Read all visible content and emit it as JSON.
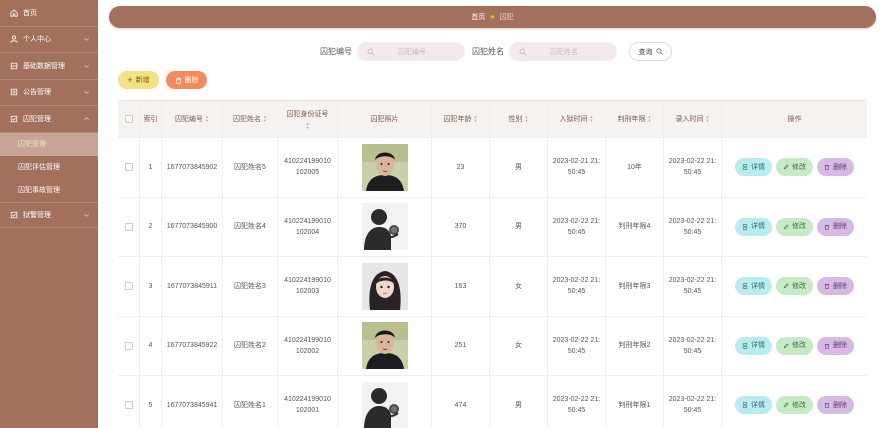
{
  "sidebar": {
    "items": [
      {
        "label": "首页",
        "icon": "home-icon"
      },
      {
        "label": "个人中心",
        "icon": "user-icon"
      },
      {
        "label": "基础数据管理",
        "icon": "database-icon"
      },
      {
        "label": "公告管理",
        "icon": "notice-icon"
      },
      {
        "label": "囚犯管理",
        "icon": "prisoner-icon"
      }
    ],
    "sub_items": [
      {
        "label": "囚犯管理",
        "active": true
      },
      {
        "label": "囚犯评估管理",
        "active": false
      },
      {
        "label": "囚犯事故管理",
        "active": false
      }
    ],
    "last_item": {
      "label": "狱警管理",
      "icon": "guard-icon"
    }
  },
  "header": {
    "crumb_home": "首页",
    "crumb_current": "囚犯"
  },
  "search": {
    "label_no": "囚犯编号",
    "placeholder_no": "囚犯编号",
    "label_name": "囚犯姓名",
    "placeholder_name": "囚犯姓名",
    "button": "查询"
  },
  "actions": {
    "add": "新增",
    "delete": "删除"
  },
  "table": {
    "headers": {
      "index": "索引",
      "no": "囚犯编号",
      "name": "囚犯姓名",
      "idcard": "囚犯身份证号",
      "photo": "囚犯照片",
      "age": "囚犯年龄",
      "sex": "性别",
      "in_time": "入狱时间",
      "term": "判刑年限",
      "rec_time": "录入时间",
      "ops": "操作"
    },
    "rows": [
      {
        "index": "1",
        "no": "1677073845902",
        "name": "囚犯姓名5",
        "idcard_a": "410224199010",
        "idcard_b": "102005",
        "photo": "man-portrait",
        "age": "23",
        "sex": "男",
        "in_a": "2023-02-21 21:",
        "in_b": "50:45",
        "term": "10年",
        "rec_a": "2023-02-22 21:",
        "rec_b": "50:45"
      },
      {
        "index": "2",
        "no": "1677073845900",
        "name": "囚犯姓名4",
        "idcard_a": "410224199010",
        "idcard_b": "102004",
        "photo": "silhouette-portrait",
        "age": "370",
        "sex": "男",
        "in_a": "2023-02-22 21:",
        "in_b": "50:45",
        "term": "判刑年限4",
        "rec_a": "2023-02-22 21:",
        "rec_b": "50:45"
      },
      {
        "index": "3",
        "no": "1677073845911",
        "name": "囚犯姓名3",
        "idcard_a": "410224199010",
        "idcard_b": "102003",
        "photo": "woman-portrait",
        "age": "163",
        "sex": "女",
        "in_a": "2023-02-22 21:",
        "in_b": "50:45",
        "term": "判刑年限3",
        "rec_a": "2023-02-22 21:",
        "rec_b": "50:45"
      },
      {
        "index": "4",
        "no": "1677073845922",
        "name": "囚犯姓名2",
        "idcard_a": "410224199010",
        "idcard_b": "102002",
        "photo": "man-portrait",
        "age": "251",
        "sex": "女",
        "in_a": "2023-02-22 21:",
        "in_b": "50:45",
        "term": "判刑年限2",
        "rec_a": "2023-02-22 21:",
        "rec_b": "50:45"
      },
      {
        "index": "5",
        "no": "1677073845941",
        "name": "囚犯姓名1",
        "idcard_a": "410224199010",
        "idcard_b": "102001",
        "photo": "silhouette-portrait",
        "age": "474",
        "sex": "男",
        "in_a": "2023-02-22 21:",
        "in_b": "50:45",
        "term": "判刑年限1",
        "rec_a": "2023-02-22 21:",
        "rec_b": "50:45"
      }
    ],
    "row_ops": {
      "detail": "详情",
      "edit": "修改",
      "delete": "删除"
    }
  },
  "colors": {
    "sidebar": "#a2705b",
    "active_sub": "#c6a597",
    "add_button": "#f3e183",
    "delete_button": "#f48a5d",
    "detail_button": "#b9ecee",
    "edit_button": "#c7eac5",
    "row_delete_button": "#d6b9e4"
  }
}
